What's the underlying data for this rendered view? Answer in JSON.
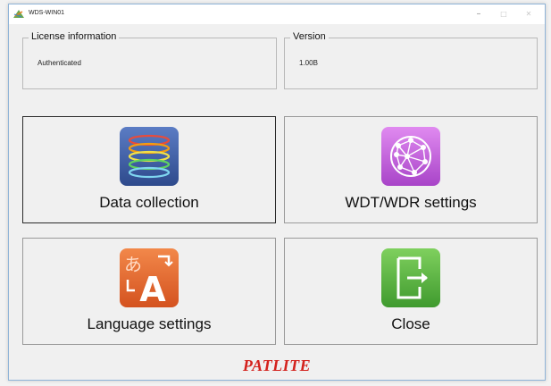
{
  "window": {
    "title": "WDS-WIN01",
    "icon": "patlite-app-icon",
    "controls": {
      "minimize": "–",
      "maximize": "□",
      "close": "✕"
    }
  },
  "license": {
    "legend": "License information",
    "value": "Authenticated"
  },
  "version": {
    "legend": "Version",
    "value": "1.00B"
  },
  "tiles": {
    "data_collection": {
      "label": "Data collection",
      "icon": "data-rings-icon"
    },
    "wdt_wdr": {
      "label": "WDT/WDR settings",
      "icon": "network-sphere-icon"
    },
    "language": {
      "label": "Language settings",
      "icon": "language-translate-icon",
      "glyph": "A",
      "kana": "あ"
    },
    "close": {
      "label": "Close",
      "icon": "exit-door-icon"
    }
  },
  "brand": {
    "name": "PATLITE",
    "color": "#d4231e"
  },
  "colors": {
    "data_icon": "#3d5aa0",
    "wdt_icon": "#c25ad8",
    "lang_icon": "#e0632b",
    "close_icon": "#4ea83a"
  }
}
